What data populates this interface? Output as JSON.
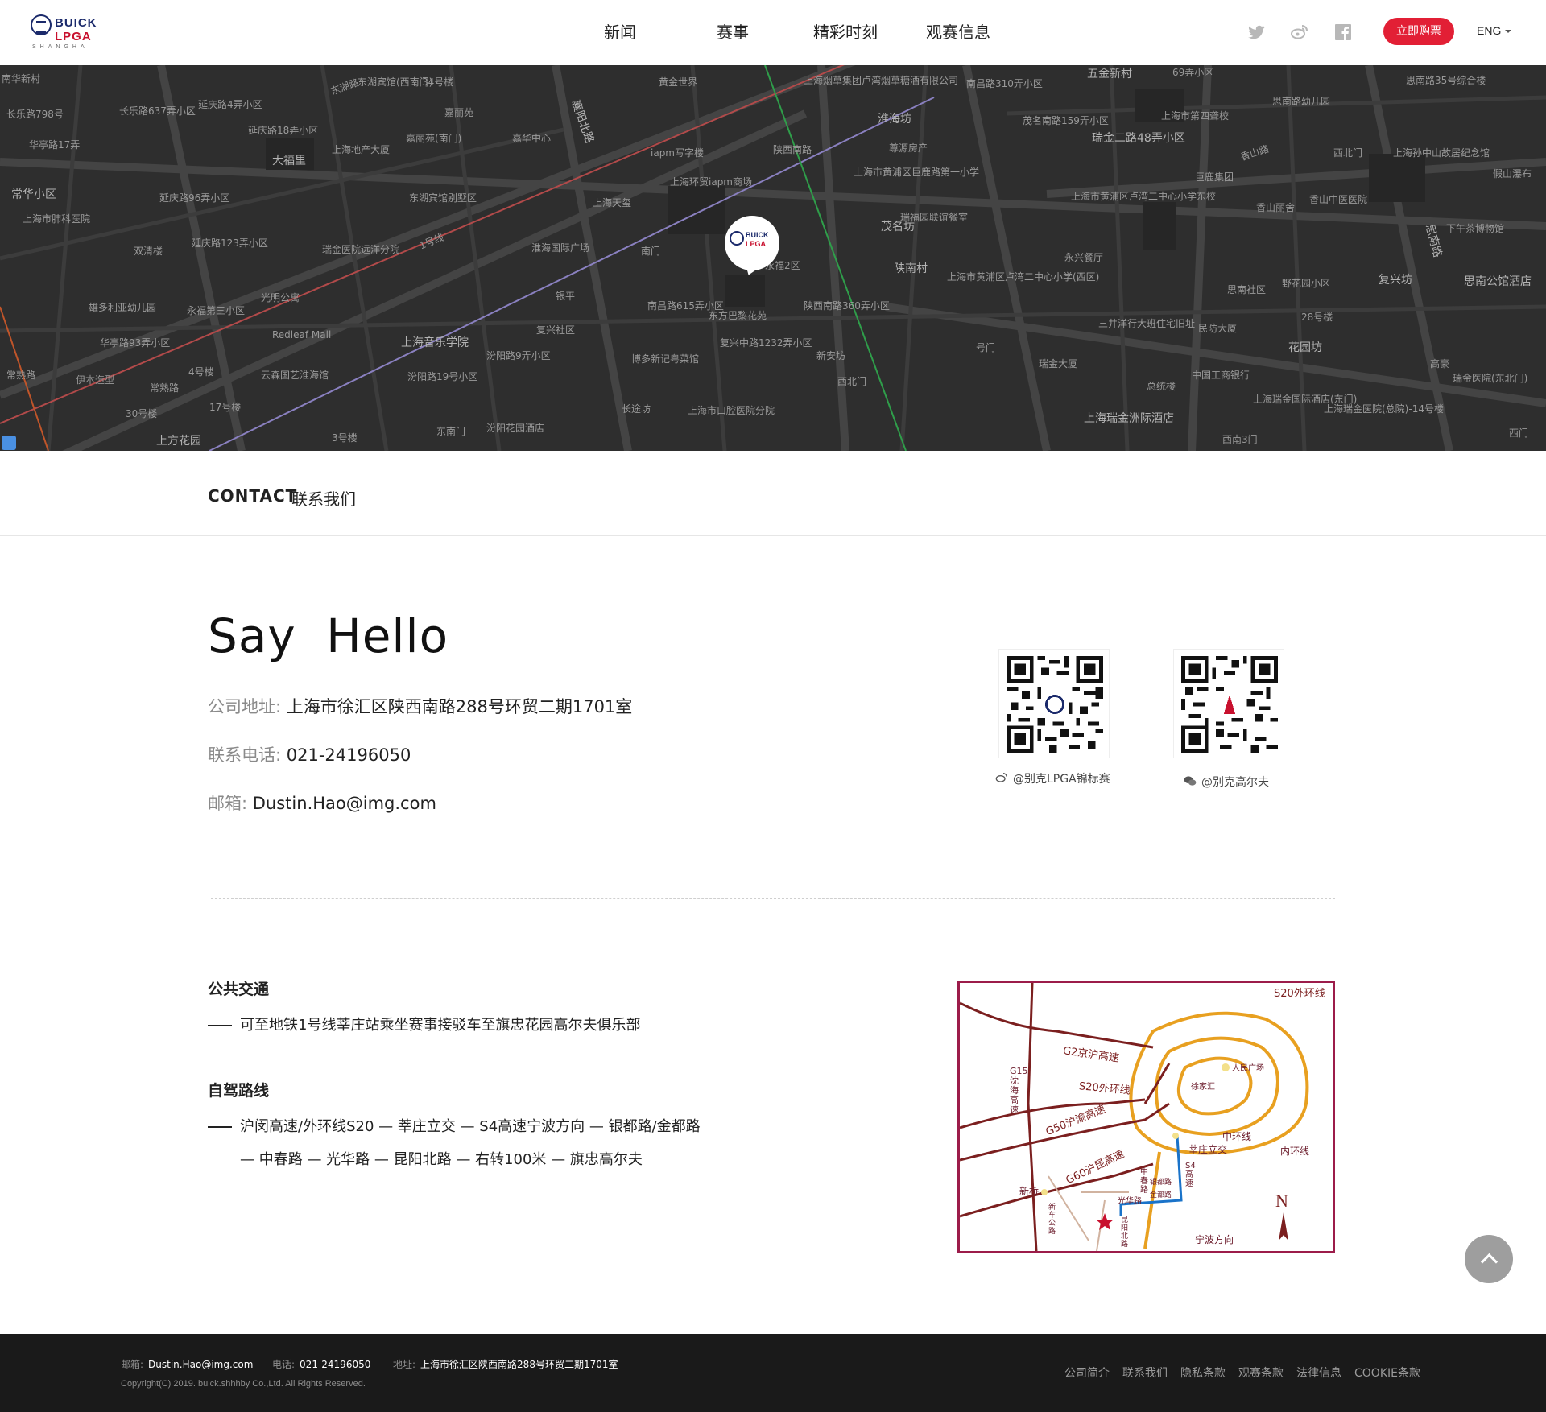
{
  "header": {
    "brand_line1": "BUICK",
    "brand_line2": "LPGA",
    "brand_line3": "SHANGHAI",
    "nav": [
      "新闻",
      "赛事",
      "精彩时刻",
      "观赛信息"
    ],
    "buy_label": "立即购票",
    "lang_label": "ENG",
    "social_icons": [
      "twitter-icon",
      "weibo-icon",
      "facebook-icon"
    ]
  },
  "map": {
    "pin_brand1": "BUICK",
    "pin_brand2": "LPGA",
    "labels": [
      "南华新村",
      "东湖路",
      "东湖宾馆(西南门)",
      "34号楼",
      "黄金世界",
      "上海烟草集团卢湾烟草糖酒有限公司",
      "南昌路310弄小区",
      "五金新村",
      "69弄小区",
      "思南路35号综合楼",
      "长乐路798号",
      "长乐路637弄小区",
      "延庆路4弄小区",
      "嘉丽苑",
      "襄阳北路",
      "陕西南路",
      "淮海坊",
      "茂名南路159弄小区",
      "瑞金二路48弄小区",
      "上海市第四聋校",
      "思南路幼儿园",
      "华亭路17弄",
      "延庆路18弄小区",
      "上海地产大厦",
      "嘉丽苑(南门)",
      "嘉华中心",
      "iapm写字楼",
      "尊源房产",
      "香山路",
      "西北门",
      "上海孙中山故居纪念馆",
      "常华小区",
      "大福里",
      "上海环贸iapm商场",
      "上海市黄浦区巨鹿路第一小学",
      "巨鹿集团",
      "香山丽舍",
      "香山中医医院",
      "假山瀑布",
      "上海市肺科医院",
      "延庆路96弄小区",
      "东湖宾馆别墅区",
      "上海天玺",
      "瑞福园联谊餐室",
      "上海市黄浦区卢湾二中心小学东校",
      "下午茶博物馆",
      "双清楼",
      "延庆路123弄小区",
      "瑞金医院远洋分院",
      "1号线",
      "淮海国际广场",
      "南门",
      "永福2区",
      "茂名坊",
      "陕南村",
      "永兴餐厅",
      "思南路",
      "思南公馆酒店",
      "雄多利亚幼儿园",
      "永福第三小区",
      "光明公寓",
      "银平",
      "南昌路615弄小区",
      "东方巴黎花苑",
      "陕西南路360弄小区",
      "上海市黄浦区卢湾二中心小学(西区)",
      "思南社区",
      "野花园小区",
      "复兴坊",
      "华亭路93弄小区",
      "Redleaf Mall",
      "上海音乐学院",
      "复兴社区",
      "复兴中路1232弄小区",
      "新安坊",
      "三井洋行大班住宅旧址",
      "民防大厦",
      "28号楼",
      "高豪",
      "常熟路",
      "伊本造型",
      "常熟路",
      "4号楼",
      "云森国艺淮海馆",
      "汾阳路9弄小区",
      "汾阳路19号小区",
      "博多新记粤菜馆",
      "号门",
      "瑞金大厦",
      "花园坊",
      "中国工商银行",
      "瑞金医院(东北门)",
      "17号楼",
      "长途坊",
      "西北门",
      "总统楼",
      "上海瑞金国际酒店(东门)",
      "上海瑞金医院(总院)-14号楼",
      "30号楼",
      "上方花园",
      "3号楼",
      "东南门",
      "汾阳花园酒店",
      "上海市口腔医院分院",
      "上海瑞金洲际酒店",
      "西南3门",
      "西门"
    ]
  },
  "contact": {
    "title_en": "CONTACT",
    "title_cn": "联系我们",
    "hello": "Say Hello",
    "address_label": "公司地址:",
    "address_value": "上海市徐汇区陕西南路288号环贸二期1701室",
    "phone_label": "联系电话:",
    "phone_value": "021-24196050",
    "email_label": "邮箱:",
    "email_value": "Dustin.Hao@img.com",
    "qr1_caption": "@别克LPGA锦标赛",
    "qr2_caption": "@别克高尔夫"
  },
  "transport": {
    "public_title": "公共交通",
    "public_text": "可至地铁1号线莘庄站乘坐赛事接驳车至旗忠花园高尔夫俱乐部",
    "drive_title": "自驾路线",
    "drive_line1": "沪闵高速/外环线S20 — 莘庄立交 — S4高速宁波方向 — 银都路/金都路",
    "drive_line2": "— 中春路 — 光华路 — 昆阳北路 — 右转100米 — 旗忠高尔夫"
  },
  "route_map": {
    "labels": [
      "S20外环线",
      "G2京沪高速",
      "人民广场",
      "S20外环线",
      "徐家汇",
      "G15沈海高速",
      "G50沪渝高速",
      "中环线",
      "莘庄立交",
      "内环线",
      "G60沪昆高速",
      "中春路",
      "银都路",
      "金都路",
      "S4高速",
      "新桥",
      "光华路",
      "新车公路",
      "昆阳北路",
      "宁波方向",
      "N"
    ],
    "accent_colors": [
      "#e8a020",
      "#7b1f1f",
      "#1a73c9"
    ]
  },
  "footer": {
    "email_label": "邮箱:",
    "email_value": "Dustin.Hao@img.com",
    "phone_label": "电话:",
    "phone_value": "021-24196050",
    "address_label": "地址:",
    "address_value": "上海市徐汇区陕西南路288号环贸二期1701室",
    "copyright": "Copyright(C) 2019. buick.shhhby Co.,Ltd. All Rights Reserved.",
    "links": [
      "公司简介",
      "联系我们",
      "隐私条款",
      "观赛条款",
      "法律信息",
      "COOKIE条款"
    ]
  },
  "colors": {
    "accent_red": "#e21f35",
    "brand_blue": "#1b2a6b",
    "map_bg": "#2e2e2e",
    "footer_bg": "#1a1a1a"
  }
}
